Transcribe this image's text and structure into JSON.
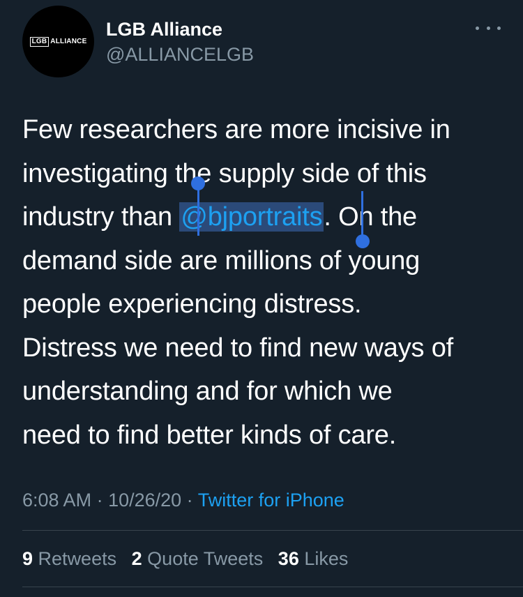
{
  "author": {
    "display_name": "LGB Alliance",
    "handle": "@ALLIANCELGB",
    "avatar_logo_box": "LGB",
    "avatar_logo_text": "ALLIANCE"
  },
  "tweet": {
    "line1": "Few researchers are more incisive in",
    "line2": "investigating the supply side of this",
    "line3_before": "industry than ",
    "mention": "@bjportraits",
    "line3_after": ". On the",
    "line4": "demand side are millions of young",
    "line5": "people experiencing distress.",
    "line6": "Distress we need to find new ways of",
    "line7": "understanding and for which we",
    "line8": "need to find better kinds of care."
  },
  "meta": {
    "time": "6:08 AM",
    "separator1": " · ",
    "date": "10/26/20",
    "separator2": " · ",
    "source": "Twitter for iPhone"
  },
  "stats": {
    "retweets_count": "9",
    "retweets_label": "Retweets",
    "quotes_count": "2",
    "quotes_label": "Quote Tweets",
    "likes_count": "36",
    "likes_label": "Likes"
  },
  "colors": {
    "background": "#15202b",
    "link": "#1da1f2",
    "secondary_text": "#8899a6",
    "selection_handle": "#2f6fdf",
    "selection_highlight": "#2b4a79"
  },
  "icons": {
    "more": "more-horizontal-icon"
  }
}
